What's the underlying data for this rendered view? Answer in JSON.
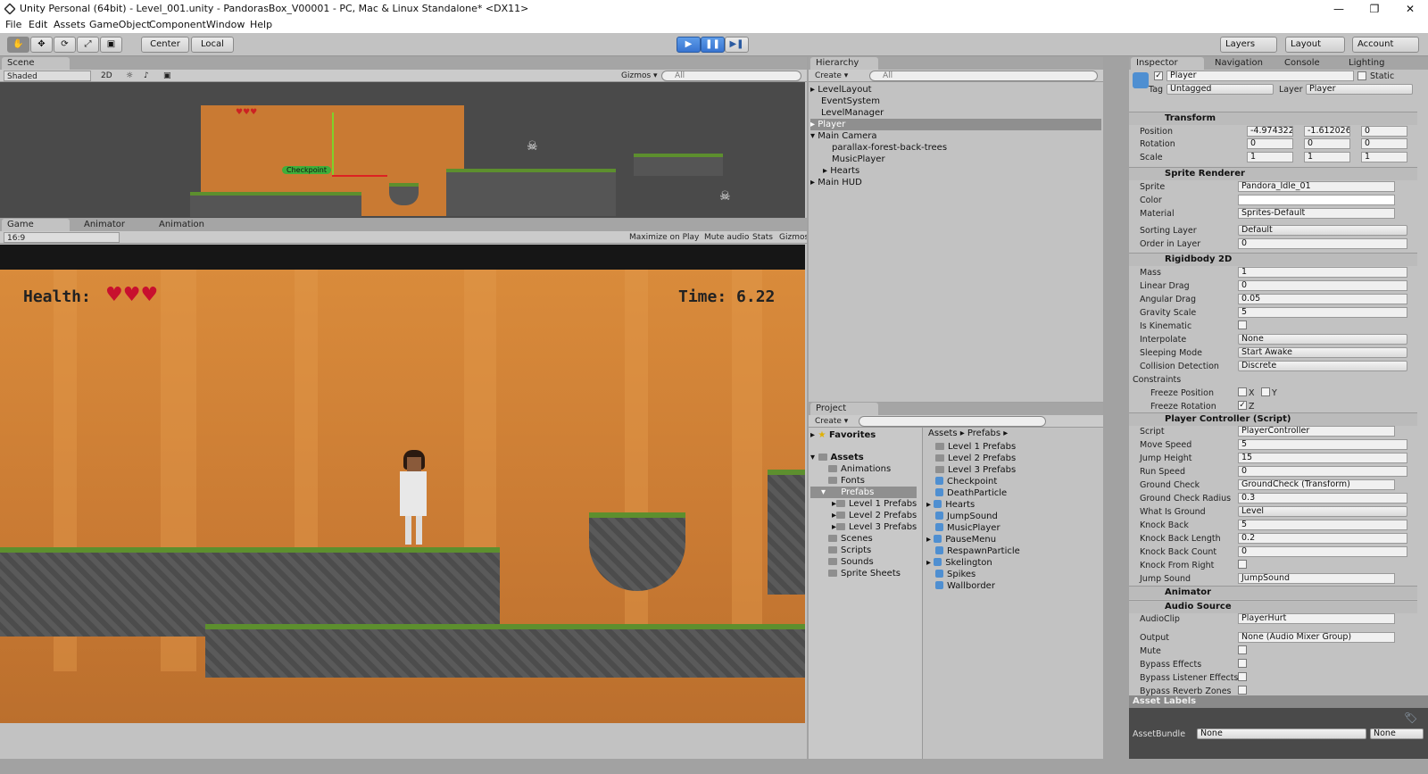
{
  "window": {
    "title": "Unity Personal (64bit) - Level_001.unity - PandorasBox_V00001 - PC, Mac & Linux Standalone* <DX11>",
    "min": "—",
    "max": "❐",
    "close": "✕"
  },
  "menu": [
    "File",
    "Edit",
    "Assets",
    "GameObject",
    "Component",
    "Window",
    "Help"
  ],
  "toolbar": {
    "center": "Center",
    "local": "Local",
    "layers": "Layers",
    "layout": "Layout",
    "account": "Account",
    "play": "▶",
    "pause": "❚❚",
    "step": "▶❚"
  },
  "scene": {
    "tab": "Scene",
    "shading": "Shaded",
    "mode2d": "2D",
    "gizmos": "Gizmos ▾",
    "search": "All",
    "checkpoint": "Checkpoint"
  },
  "game": {
    "tab": "Game",
    "animator_tab": "Animator",
    "animation_tab": "Animation",
    "aspect": "16:9",
    "maximize": "Maximize on Play",
    "mute": "Mute audio",
    "stats": "Stats",
    "gizmos": "Gizmos ▾",
    "health_label": "Health:",
    "time_label": "Time: 6.22",
    "hearts": "♥♥♥",
    "hearts_scene": "♥♥♥"
  },
  "hierarchy": {
    "tab": "Hierarchy",
    "create": "Create ▾",
    "search": "All",
    "items": [
      "LevelLayout",
      "EventSystem",
      "LevelManager",
      "Player",
      "Main Camera",
      "parallax-forest-back-trees",
      "MusicPlayer",
      "Hearts",
      "Main HUD"
    ]
  },
  "project": {
    "tab": "Project",
    "create": "Create ▾",
    "favorites": "Favorites",
    "assets": "Assets",
    "folders": [
      "Animations",
      "Fonts",
      "Prefabs",
      "Level 1 Prefabs",
      "Level 2 Prefabs",
      "Level 3 Prefabs",
      "Scenes",
      "Scripts",
      "Sounds",
      "Sprite Sheets"
    ],
    "breadcrumb": "Assets ▸ Prefabs ▸",
    "files": [
      "Level 1 Prefabs",
      "Level 2 Prefabs",
      "Level 3 Prefabs",
      "Checkpoint",
      "DeathParticle",
      "Hearts",
      "JumpSound",
      "MusicPlayer",
      "PauseMenu",
      "RespawnParticle",
      "Skelington",
      "Spikes",
      "Wallborder"
    ]
  },
  "inspector": {
    "tabs": [
      "Inspector",
      "Navigation",
      "Console",
      "Lighting"
    ],
    "name": "Player",
    "static": "Static",
    "tag_label": "Tag",
    "tag": "Untagged",
    "layer_label": "Layer",
    "layer": "Player",
    "transform": {
      "title": "Transform",
      "position": "Position",
      "rotation": "Rotation",
      "scale": "Scale",
      "px": "-4.974322",
      "py": "-1.612026",
      "pz": "0",
      "rx": "0",
      "ry": "0",
      "rz": "0",
      "sx": "1",
      "sy": "1",
      "sz": "1"
    },
    "sprite_renderer": {
      "title": "Sprite Renderer",
      "sprite_label": "Sprite",
      "sprite": "Pandora_Idle_01",
      "color_label": "Color",
      "material_label": "Material",
      "material": "Sprites-Default",
      "sorting_label": "Sorting Layer",
      "sorting": "Default",
      "order_label": "Order in Layer",
      "order": "0"
    },
    "rigidbody": {
      "title": "Rigidbody 2D",
      "mass_l": "Mass",
      "mass": "1",
      "ldrag_l": "Linear Drag",
      "ldrag": "0",
      "adrag_l": "Angular Drag",
      "adrag": "0.05",
      "grav_l": "Gravity Scale",
      "grav": "5",
      "kin_l": "Is Kinematic",
      "interp_l": "Interpolate",
      "interp": "None",
      "sleep_l": "Sleeping Mode",
      "sleep": "Start Awake",
      "coll_l": "Collision Detection",
      "coll": "Discrete",
      "constraints": "Constraints",
      "fpos": "Freeze Position",
      "frot": "Freeze Rotation",
      "x": "X",
      "y": "Y",
      "z": "Z"
    },
    "controller": {
      "title": "Player Controller (Script)",
      "script_l": "Script",
      "script": "PlayerController",
      "move_l": "Move Speed",
      "move": "5",
      "jump_l": "Jump Height",
      "jump": "15",
      "run_l": "Run Speed",
      "run": "0",
      "gc_l": "Ground Check",
      "gc": "GroundCheck (Transform)",
      "gcr_l": "Ground Check Radius",
      "gcr": "0.3",
      "wig_l": "What Is Ground",
      "wig": "Level",
      "kb_l": "Knock Back",
      "kb": "5",
      "kbl_l": "Knock Back Length",
      "kbl": "0.2",
      "kbc_l": "Knock Back Count",
      "kbc": "0",
      "kfr_l": "Knock From Right",
      "js_l": "Jump Sound",
      "js": "JumpSound"
    },
    "animator": {
      "title": "Animator"
    },
    "audio": {
      "title": "Audio Source",
      "clip_l": "AudioClip",
      "clip": "PlayerHurt",
      "out_l": "Output",
      "out": "None (Audio Mixer Group)",
      "mute_l": "Mute",
      "be_l": "Bypass Effects",
      "ble_l": "Bypass Listener Effects",
      "brz_l": "Bypass Reverb Zones"
    },
    "asset_labels": "Asset Labels",
    "assetbundle_l": "AssetBundle",
    "assetbundle": "None",
    "variant": "None"
  }
}
